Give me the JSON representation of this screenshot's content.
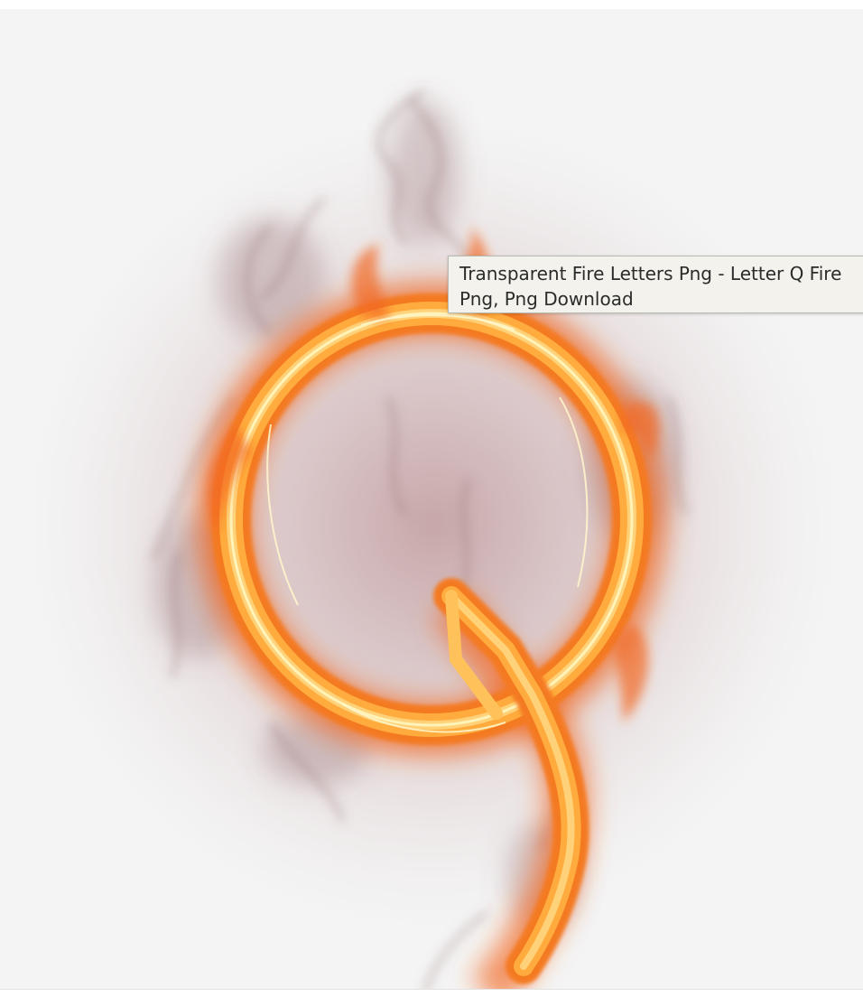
{
  "image": {
    "alt_icon": "fire-letter-q-image",
    "colors": {
      "flame_core": "#fff1a8",
      "flame_mid": "#ffb347",
      "flame_outer": "#f26a21",
      "smoke": "#9a6e70",
      "glow": "#c9a6a8",
      "background": "#f4f4f4"
    }
  },
  "tooltip": {
    "line1": "Transparent Fire Letters Png - Letter Q Fire",
    "line2": "Png, Png Download"
  }
}
